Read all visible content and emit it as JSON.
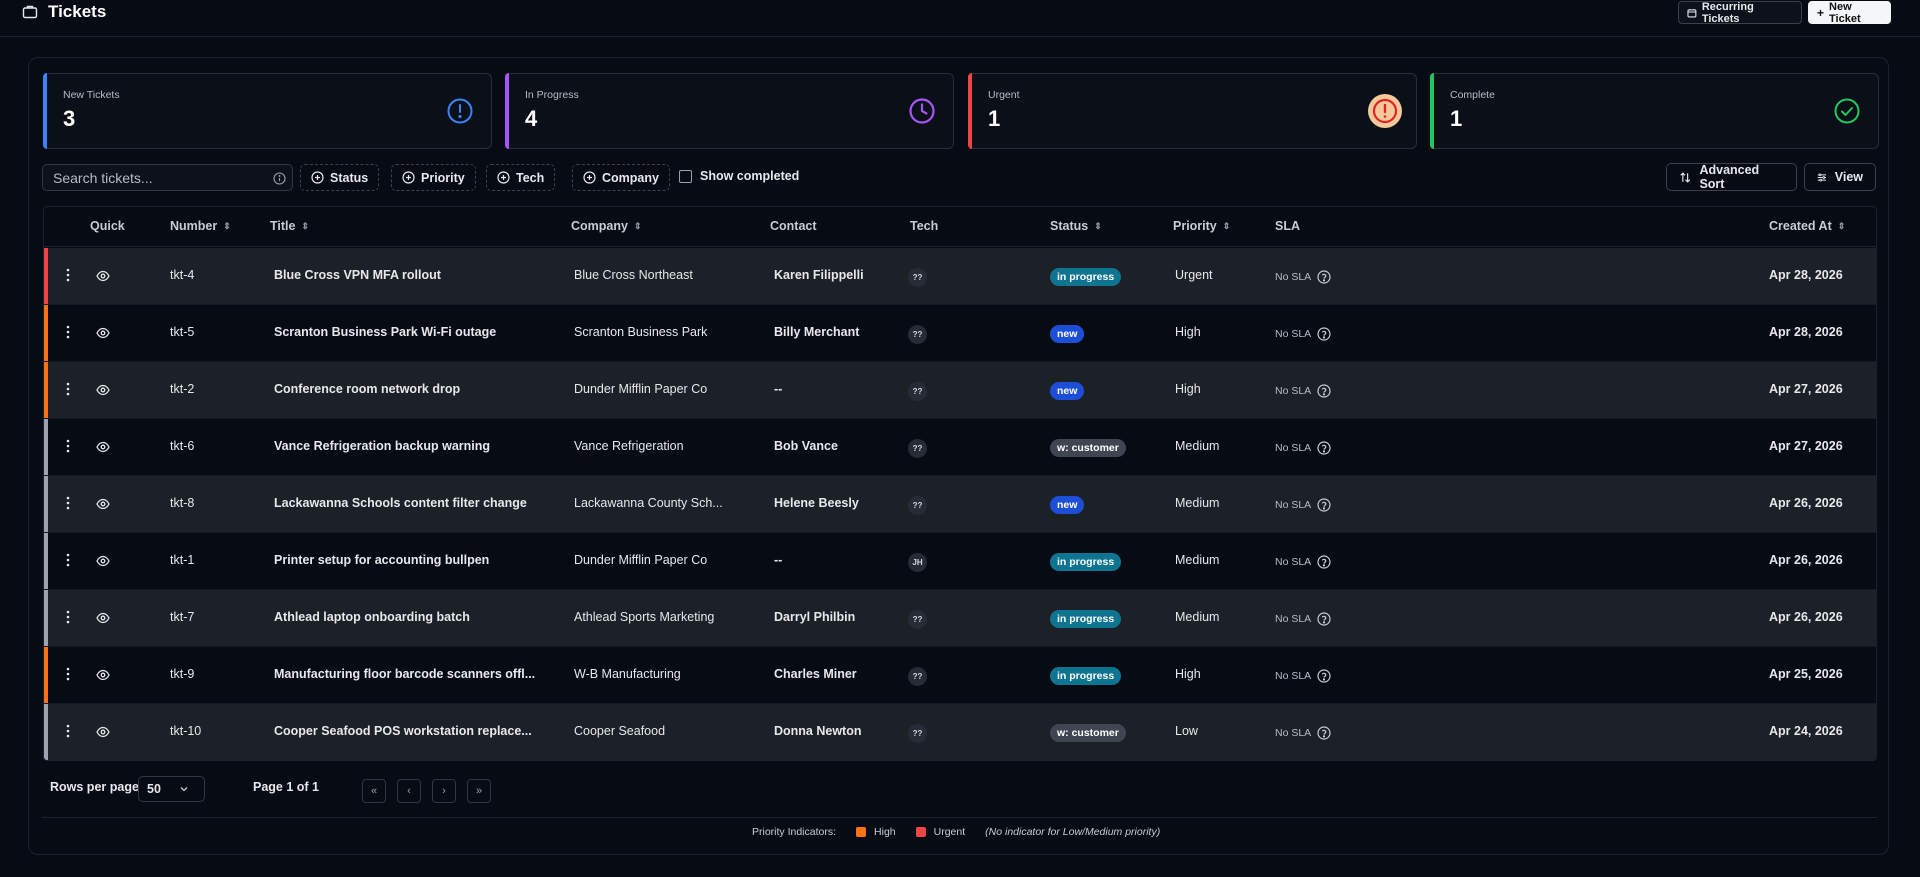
{
  "header": {
    "title": "Tickets",
    "recurring_label": "Recurring Tickets",
    "new_label": "New Ticket"
  },
  "cards": [
    {
      "label": "New Tickets",
      "value": "3",
      "color": "#3b82f6",
      "icon": "alert-circle-icon"
    },
    {
      "label": "In Progress",
      "value": "4",
      "color": "#a855f7",
      "icon": "clock-icon"
    },
    {
      "label": "Urgent",
      "value": "1",
      "color": "#ef4444",
      "icon": "alert-circle-filled-icon"
    },
    {
      "label": "Complete",
      "value": "1",
      "color": "#22c55e",
      "icon": "check-circle-icon"
    }
  ],
  "toolbar": {
    "search_placeholder": "Search tickets...",
    "filters": [
      "Status",
      "Priority",
      "Tech",
      "Company"
    ],
    "show_completed": "Show completed",
    "advanced_sort": "Advanced Sort",
    "view": "View"
  },
  "columns": {
    "quick": "Quick",
    "number": "Number",
    "title": "Title",
    "company": "Company",
    "contact": "Contact",
    "tech": "Tech",
    "status": "Status",
    "priority": "Priority",
    "sla": "SLA",
    "created": "Created At"
  },
  "rows": [
    {
      "number": "tkt-4",
      "title": "Blue Cross VPN MFA rollout",
      "company": "Blue Cross Northeast",
      "contact": "Karen Filippelli",
      "tech": "??",
      "status": "in progress",
      "priority": "Urgent",
      "sla": "No SLA",
      "created": "Apr 28, 2026"
    },
    {
      "number": "tkt-5",
      "title": "Scranton Business Park Wi-Fi outage",
      "company": "Scranton Business Park",
      "contact": "Billy Merchant",
      "tech": "??",
      "status": "new",
      "priority": "High",
      "sla": "No SLA",
      "created": "Apr 28, 2026"
    },
    {
      "number": "tkt-2",
      "title": "Conference room network drop",
      "company": "Dunder Mifflin Paper Co",
      "contact": "--",
      "tech": "??",
      "status": "new",
      "priority": "High",
      "sla": "No SLA",
      "created": "Apr 27, 2026"
    },
    {
      "number": "tkt-6",
      "title": "Vance Refrigeration backup warning",
      "company": "Vance Refrigeration",
      "contact": "Bob Vance",
      "tech": "??",
      "status": "w: customer",
      "priority": "Medium",
      "sla": "No SLA",
      "created": "Apr 27, 2026"
    },
    {
      "number": "tkt-8",
      "title": "Lackawanna Schools content filter change",
      "company": "Lackawanna County Sch...",
      "contact": "Helene Beesly",
      "tech": "??",
      "status": "new",
      "priority": "Medium",
      "sla": "No SLA",
      "created": "Apr 26, 2026"
    },
    {
      "number": "tkt-1",
      "title": "Printer setup for accounting bullpen",
      "company": "Dunder Mifflin Paper Co",
      "contact": "--",
      "tech": "JH",
      "status": "in progress",
      "priority": "Medium",
      "sla": "No SLA",
      "created": "Apr 26, 2026"
    },
    {
      "number": "tkt-7",
      "title": "Athlead laptop onboarding batch",
      "company": "Athlead Sports Marketing",
      "contact": "Darryl Philbin",
      "tech": "??",
      "status": "in progress",
      "priority": "Medium",
      "sla": "No SLA",
      "created": "Apr 26, 2026"
    },
    {
      "number": "tkt-9",
      "title": "Manufacturing floor barcode scanners offl...",
      "company": "W-B Manufacturing",
      "contact": "Charles Miner",
      "tech": "??",
      "status": "in progress",
      "priority": "High",
      "sla": "No SLA",
      "created": "Apr 25, 2026"
    },
    {
      "number": "tkt-10",
      "title": "Cooper Seafood POS workstation replace...",
      "company": "Cooper Seafood",
      "contact": "Donna Newton",
      "tech": "??",
      "status": "w: customer",
      "priority": "Low",
      "sla": "No SLA",
      "created": "Apr 24, 2026"
    }
  ],
  "pagination": {
    "rows_per_page_label": "Rows per page",
    "rows_per_page": "50",
    "page_label": "Page 1 of 1"
  },
  "legend": {
    "label": "Priority Indicators:",
    "high": "High",
    "urgent": "Urgent",
    "note": "(No indicator for Low/Medium priority)"
  },
  "colors": {
    "high": "#f97316",
    "urgent": "#ef4444",
    "neutral": "#9ca3af"
  }
}
